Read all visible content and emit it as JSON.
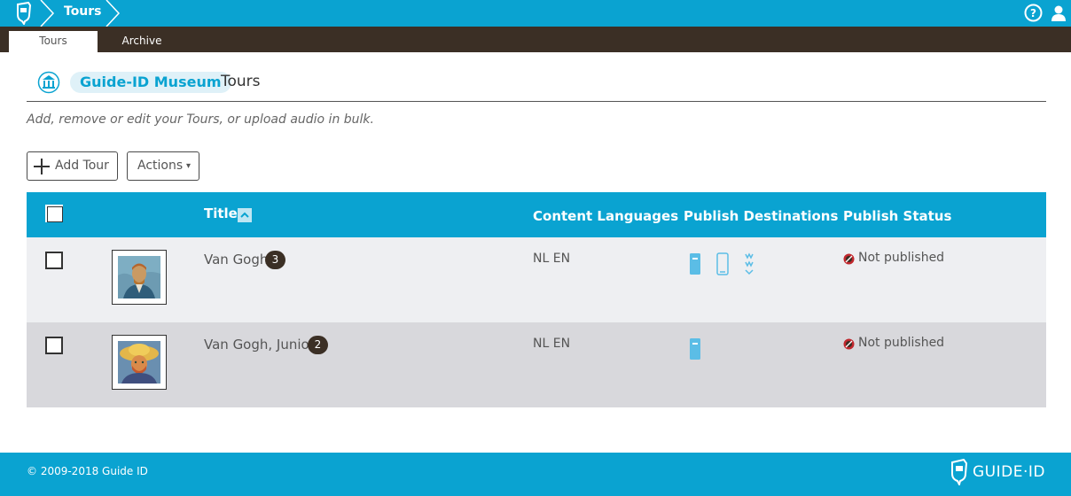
{
  "topbar": {
    "breadcrumb": "Tours",
    "help_icon": "question-circle-icon",
    "user_icon": "user-icon"
  },
  "tabs": [
    {
      "label": "Tours",
      "active": true
    },
    {
      "label": "Archive",
      "active": false
    }
  ],
  "header": {
    "museum_name": "Guide-ID Museum",
    "page_title": "Tours",
    "subtitle": "Add, remove or edit your Tours, or upload audio in bulk."
  },
  "toolbar": {
    "add_label": "Add Tour",
    "actions_label": "Actions",
    "actions_caret": "▾"
  },
  "table": {
    "columns": [
      "Title",
      "Content Languages",
      "Publish Destinations",
      "Publish Status"
    ],
    "rows": [
      {
        "title": "Van Gogh",
        "count": "3",
        "languages": "NL EN",
        "destinations": [
          "device-icon",
          "phone-icon",
          "web-icon"
        ],
        "status": "Not published"
      },
      {
        "title": "Van Gogh, Junior",
        "count": "2",
        "languages": "NL EN",
        "destinations": [
          "device-icon"
        ],
        "status": "Not published"
      }
    ]
  },
  "footer": {
    "copyright": "© 2009-2018 Guide ID",
    "brand": "GUIDE·ID"
  },
  "colors": {
    "primary": "#0aa3d1",
    "dark": "#3b2f25",
    "row_odd": "#eeeff2",
    "row_even": "#d8d8dc"
  }
}
